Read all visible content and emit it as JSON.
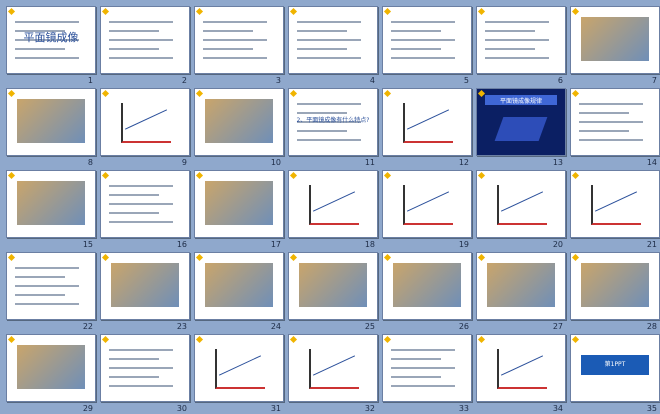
{
  "slides": [
    {
      "n": "1",
      "kind": "title",
      "title": "平面镜成像"
    },
    {
      "n": "2",
      "kind": "text"
    },
    {
      "n": "3",
      "kind": "text"
    },
    {
      "n": "4",
      "kind": "text"
    },
    {
      "n": "5",
      "kind": "text"
    },
    {
      "n": "6",
      "kind": "text"
    },
    {
      "n": "7",
      "kind": "photo"
    },
    {
      "n": "8",
      "kind": "photo"
    },
    {
      "n": "9",
      "kind": "diagram"
    },
    {
      "n": "10",
      "kind": "photo"
    },
    {
      "n": "11",
      "kind": "title2",
      "title": "2、平面镜成像有什么特点?"
    },
    {
      "n": "12",
      "kind": "diagram"
    },
    {
      "n": "13",
      "kind": "dark",
      "title": "平面镜成像规律"
    },
    {
      "n": "14",
      "kind": "text"
    },
    {
      "n": "15",
      "kind": "photo"
    },
    {
      "n": "16",
      "kind": "text"
    },
    {
      "n": "17",
      "kind": "photo"
    },
    {
      "n": "18",
      "kind": "diagram"
    },
    {
      "n": "19",
      "kind": "diagram"
    },
    {
      "n": "20",
      "kind": "diagram"
    },
    {
      "n": "21",
      "kind": "diagram"
    },
    {
      "n": "22",
      "kind": "text"
    },
    {
      "n": "23",
      "kind": "photo"
    },
    {
      "n": "24",
      "kind": "photo"
    },
    {
      "n": "25",
      "kind": "photo"
    },
    {
      "n": "26",
      "kind": "photo"
    },
    {
      "n": "27",
      "kind": "photo"
    },
    {
      "n": "28",
      "kind": "photo"
    },
    {
      "n": "29",
      "kind": "photo"
    },
    {
      "n": "30",
      "kind": "text"
    },
    {
      "n": "31",
      "kind": "diagram"
    },
    {
      "n": "32",
      "kind": "diagram"
    },
    {
      "n": "33",
      "kind": "text"
    },
    {
      "n": "34",
      "kind": "diagram"
    },
    {
      "n": "35",
      "kind": "brand",
      "title": "第1PPT"
    }
  ],
  "colors": {
    "background": "#8fa8cc",
    "slide": "#ffffff",
    "border": "#6b7fa3",
    "title": "#2a4f9a",
    "dark": "#0b1f63",
    "accent": "#f0b400"
  }
}
